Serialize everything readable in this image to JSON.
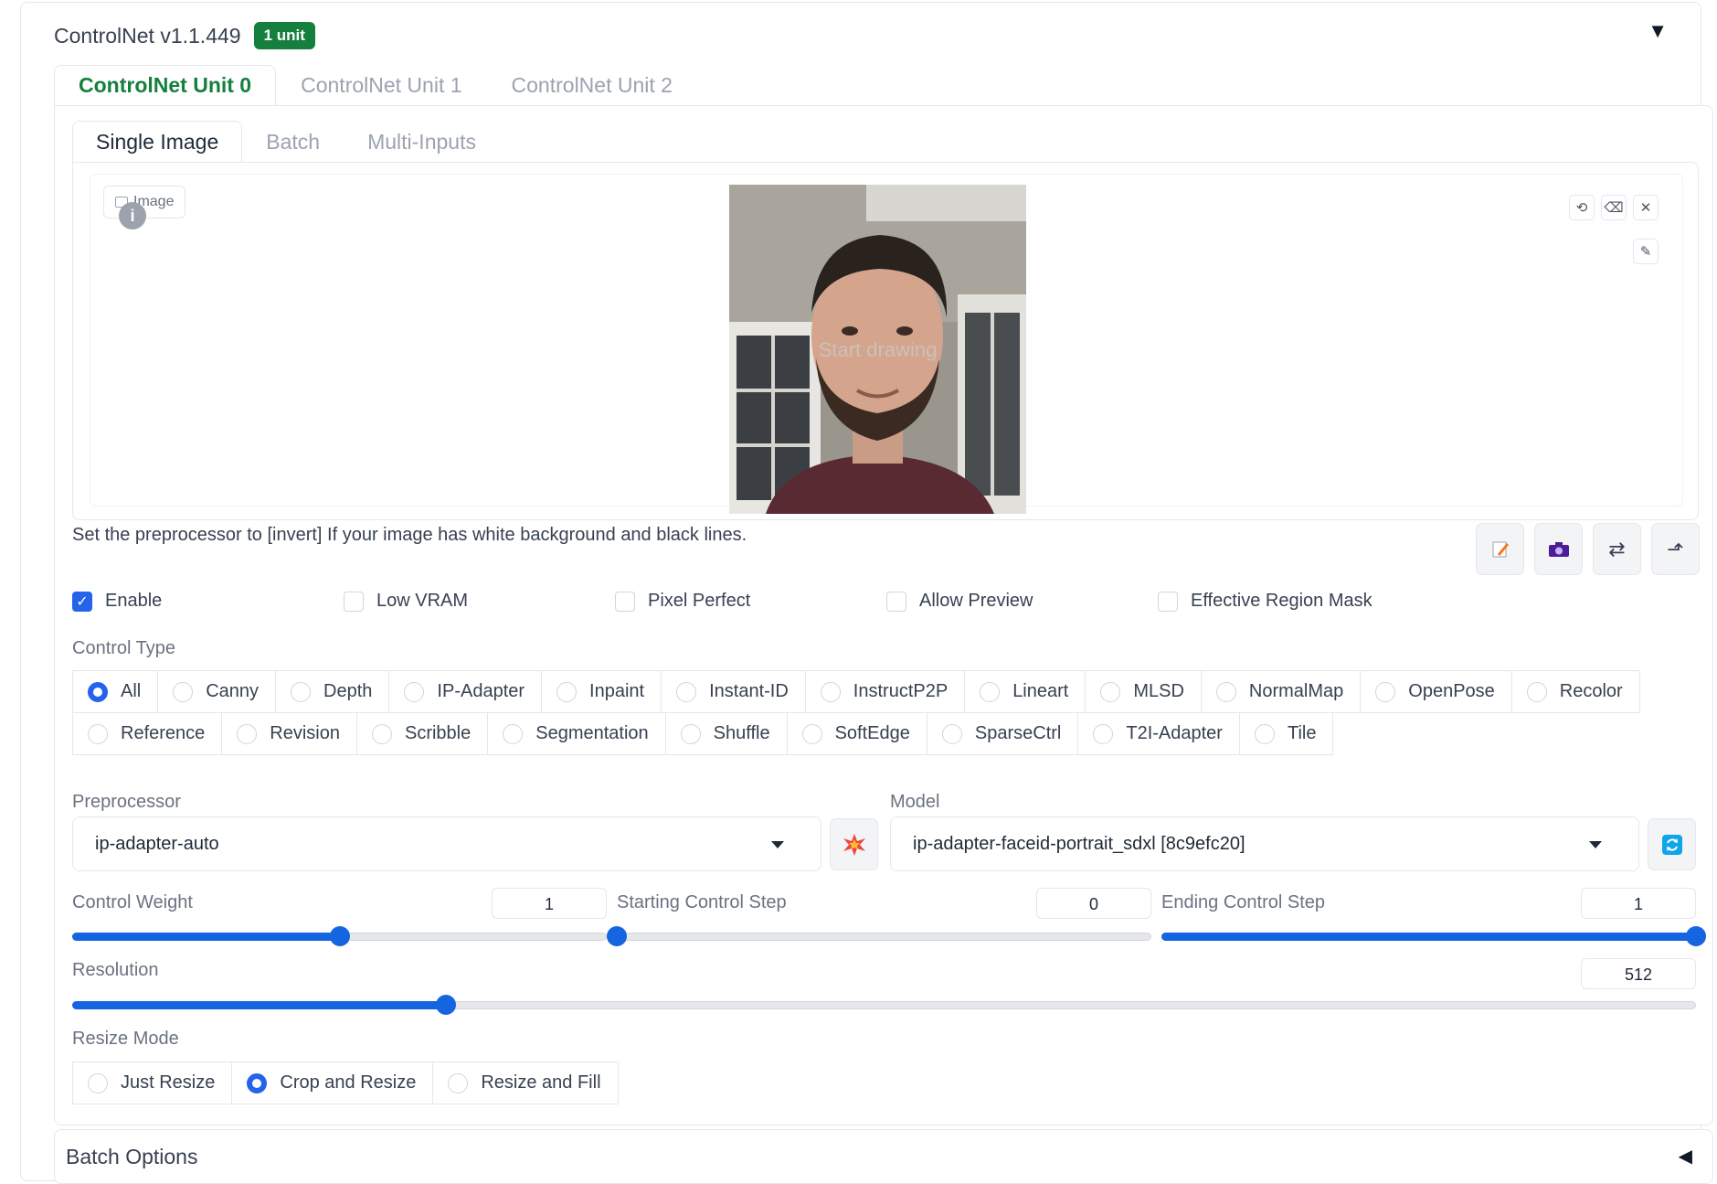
{
  "header": {
    "title": "ControlNet v1.1.449",
    "badge": "1 unit"
  },
  "unit_tabs": [
    {
      "label": "ControlNet Unit 0",
      "active": true
    },
    {
      "label": "ControlNet Unit 1",
      "active": false
    },
    {
      "label": "ControlNet Unit 2",
      "active": false
    }
  ],
  "input_tabs": [
    {
      "label": "Single Image",
      "active": true
    },
    {
      "label": "Batch",
      "active": false
    },
    {
      "label": "Multi-Inputs",
      "active": false
    }
  ],
  "image_panel": {
    "label": "Image",
    "overlay_text": "Start drawing"
  },
  "hint": "Set the preprocessor to [invert] If your image has white background and black lines.",
  "checkboxes": [
    {
      "label": "Enable",
      "checked": true
    },
    {
      "label": "Low VRAM",
      "checked": false
    },
    {
      "label": "Pixel Perfect",
      "checked": false
    },
    {
      "label": "Allow Preview",
      "checked": false
    },
    {
      "label": "Effective Region Mask",
      "checked": false
    }
  ],
  "control_type": {
    "label": "Control Type",
    "selected": "All",
    "options": [
      "All",
      "Canny",
      "Depth",
      "IP-Adapter",
      "Inpaint",
      "Instant-ID",
      "InstructP2P",
      "Lineart",
      "MLSD",
      "NormalMap",
      "OpenPose",
      "Recolor",
      "Reference",
      "Revision",
      "Scribble",
      "Segmentation",
      "Shuffle",
      "SoftEdge",
      "SparseCtrl",
      "T2I-Adapter",
      "Tile"
    ]
  },
  "preprocessor": {
    "label": "Preprocessor",
    "value": "ip-adapter-auto"
  },
  "model": {
    "label": "Model",
    "value": "ip-adapter-faceid-portrait_sdxl [8c9efc20]"
  },
  "sliders": {
    "control_weight": {
      "label": "Control Weight",
      "value": "1",
      "fraction": 0.5
    },
    "starting_step": {
      "label": "Starting Control Step",
      "value": "0",
      "fraction": 0.0
    },
    "ending_step": {
      "label": "Ending Control Step",
      "value": "1",
      "fraction": 1.0
    },
    "resolution": {
      "label": "Resolution",
      "value": "512",
      "fraction": 0.23
    }
  },
  "resize_mode": {
    "label": "Resize Mode",
    "selected": "Crop and Resize",
    "options": [
      "Just Resize",
      "Crop and Resize",
      "Resize and Fill"
    ]
  },
  "batch_options": {
    "title": "Batch Options"
  },
  "colors": {
    "accent": "#2563eb",
    "slider": "#1565e0",
    "active_tab": "#15803d",
    "badge_bg": "#15803d"
  }
}
